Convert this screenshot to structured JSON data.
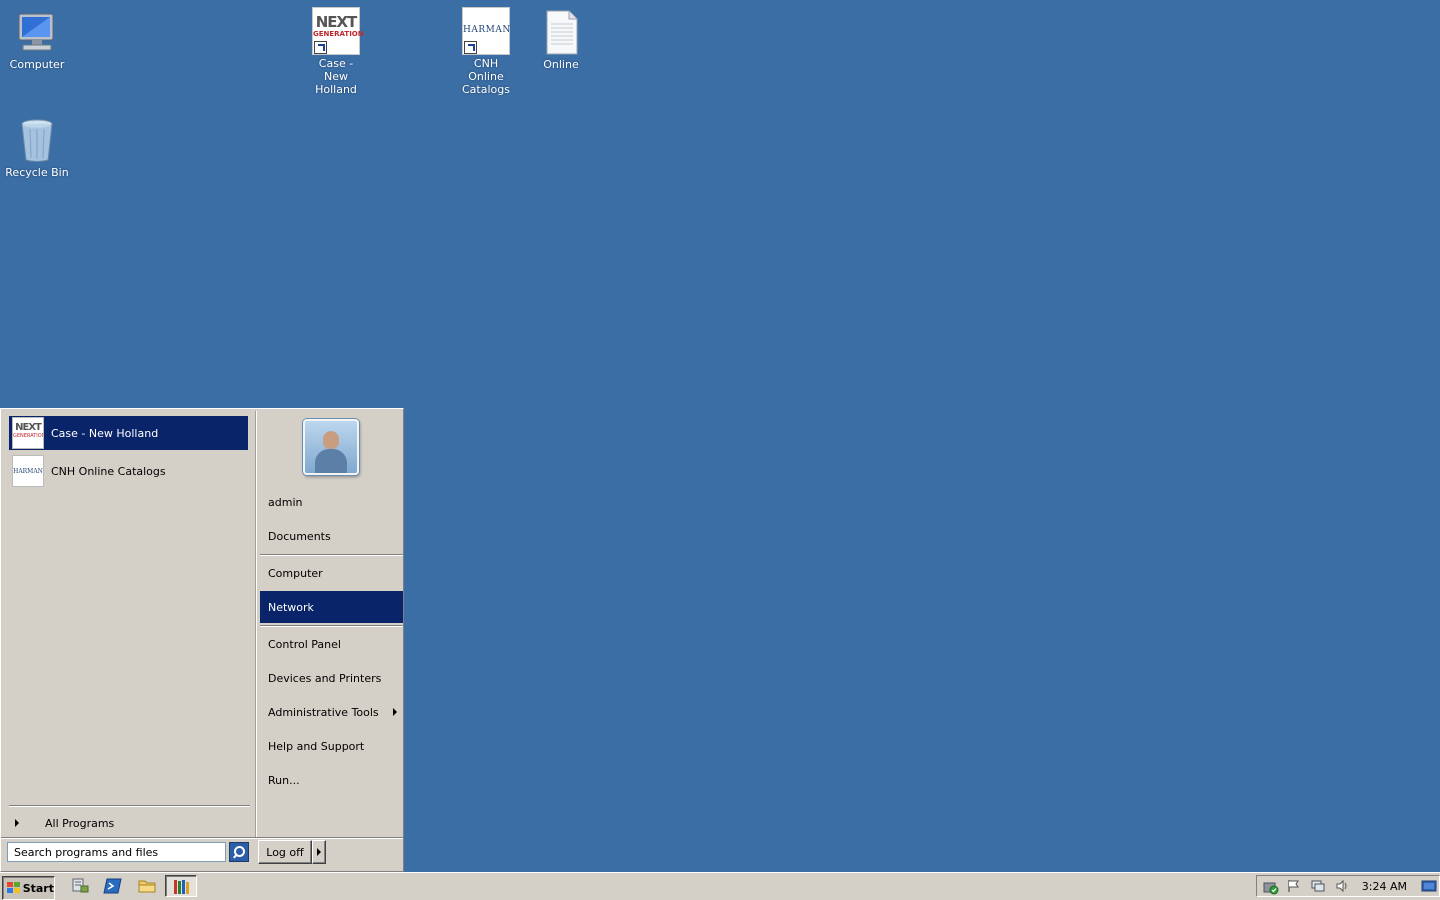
{
  "desktop": {
    "icons": [
      {
        "label": "Computer"
      },
      {
        "label": "Case - New Holland",
        "logo_text_1": "NEXT",
        "logo_text_2": "GENERATION"
      },
      {
        "label": "CNH Online Catalogs",
        "logo_text": "HARMAN"
      },
      {
        "label": "Online"
      },
      {
        "label": "Recycle Bin"
      }
    ]
  },
  "start_menu": {
    "pinned": [
      {
        "label": "Case - New Holland",
        "logo_text_1": "NEXT",
        "logo_text_2": "GENERATION"
      },
      {
        "label": "CNH Online Catalogs",
        "logo_text": "HARMAN"
      }
    ],
    "all_programs": "All Programs",
    "search_placeholder": "Search programs and files",
    "user": "admin",
    "right_items": [
      "Documents",
      "Computer",
      "Network",
      "Control Panel",
      "Devices and Printers",
      "Administrative Tools",
      "Help and Support",
      "Run..."
    ],
    "log_off": "Log off"
  },
  "taskbar": {
    "start_label": "Start",
    "clock": "3:24 AM"
  },
  "colors": {
    "desktop_bg": "#3b6ea5",
    "selection": "#0a246a",
    "menu_bg": "#d4d0c8"
  }
}
